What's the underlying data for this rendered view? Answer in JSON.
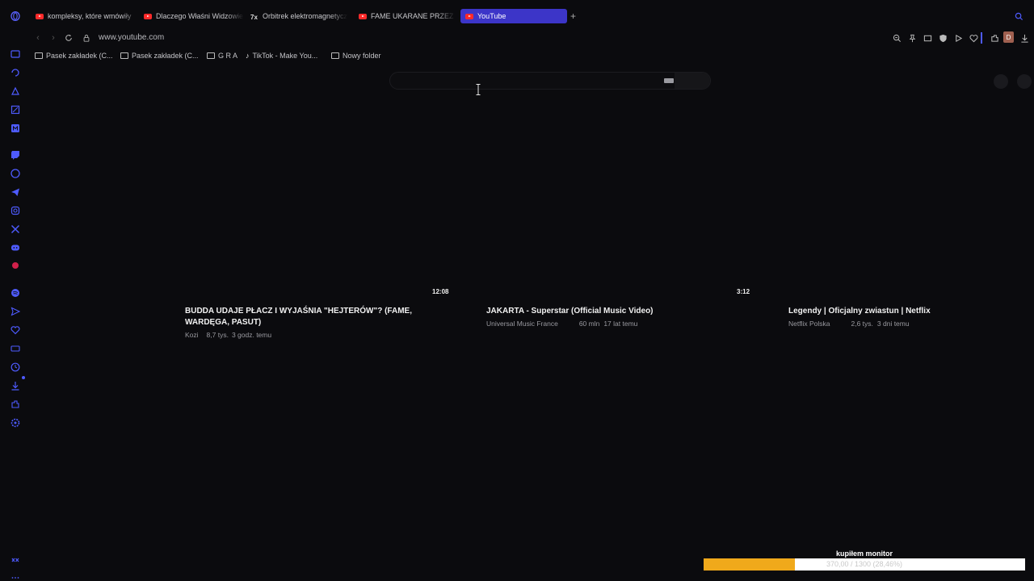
{
  "tabs": [
    {
      "label": "kompleksy, które wmówiły",
      "favicon": "youtube-icon"
    },
    {
      "label": "Dlaczego Właśni Widzowie",
      "favicon": "youtube-icon"
    },
    {
      "label": "Orbitrek elektromagnetyczny",
      "favicon": "orbitrek-icon"
    },
    {
      "label": "FAME UKARANE PRZEZ ORLEN",
      "favicon": "youtube-icon"
    },
    {
      "label": "YouTube",
      "favicon": "youtube-icon",
      "active": true
    }
  ],
  "address": {
    "url": "www.youtube.com"
  },
  "profile": {
    "initial": "D"
  },
  "bookmarks": [
    {
      "label": "Pasek zakładek (C...",
      "icon": "folder-icon"
    },
    {
      "label": "Pasek zakładek (C...",
      "icon": "folder-icon"
    },
    {
      "label": "G R A",
      "icon": "folder-icon"
    },
    {
      "label": "TikTok - Make You...",
      "icon": "tiktok-icon"
    },
    {
      "label": "Nowy folder",
      "icon": "folder-icon"
    }
  ],
  "videos": [
    {
      "duration": "12:08",
      "title": "BUDDA UDAJE PŁACZ I WYJAŚNIA \"HEJTERÓW\"? (FAME, WARDĘGA, PASUT)",
      "channel": "Kozi",
      "views": "8,7 tys.",
      "age": "3 godz. temu"
    },
    {
      "duration": "3:12",
      "title": "JAKARTA - Superstar (Official Music Video)",
      "channel": "Universal Music France",
      "views": "60 mln",
      "age": "17 lat temu"
    },
    {
      "duration": "",
      "title": "Legendy | Oficjalny zwiastun | Netflix",
      "channel": "Netflix Polska",
      "views": "2,6 tys.",
      "age": "3 dni temu"
    }
  ],
  "overlay": {
    "title": "kupiłem monitor",
    "progress_text": "370,00 / 1300 (28,46%)",
    "progress_fraction": 0.2846,
    "fill_color": "#f0a91b"
  },
  "colors": {
    "active_tab": "#3c35c8",
    "sidebar_accent": "#4e5bff"
  }
}
